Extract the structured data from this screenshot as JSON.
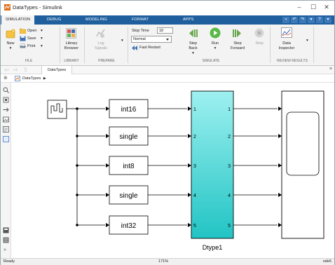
{
  "window": {
    "title": "DataTypes - Simulink",
    "minimize": "–",
    "maximize": "☐",
    "close": "✕"
  },
  "tabs": [
    {
      "label": "SIMULATION",
      "active": true
    },
    {
      "label": "DEBUG"
    },
    {
      "label": "MODELING"
    },
    {
      "label": "FORMAT"
    },
    {
      "label": "APPS"
    }
  ],
  "ribbon": {
    "file": {
      "group_label": "FILE",
      "new_label": "New",
      "open_label": "Open",
      "save_label": "Save",
      "print_label": "Print"
    },
    "library": {
      "group_label": "LIBRARY",
      "browser_label_1": "Library",
      "browser_label_2": "Browser"
    },
    "prepare": {
      "group_label": "PREPARE",
      "log_label_1": "Log",
      "log_label_2": "Signals"
    },
    "simulate": {
      "group_label": "SIMULATE",
      "stop_time_label": "Stop Time",
      "stop_time_value": "10",
      "mode_value": "Normal",
      "fast_restart_label": "Fast Restart",
      "step_back_1": "Step",
      "step_back_2": "Back",
      "run_label": "Run",
      "step_fwd_1": "Step",
      "step_fwd_2": "Forward",
      "stop_label": "Stop"
    },
    "review": {
      "group_label": "REVIEW RESULTS",
      "inspector_1": "Data",
      "inspector_2": "Inspector"
    }
  },
  "nav": {
    "tab_label": "DataTypes",
    "breadcrumb": "DataTypes"
  },
  "diagram": {
    "conversions": [
      "int16",
      "single",
      "int8",
      "single",
      "int32"
    ],
    "subsystem_name": "Dtype1",
    "ports_in": [
      "1",
      "2",
      "3",
      "4",
      "5"
    ],
    "ports_out": [
      "1",
      "2",
      "3",
      "4",
      "5"
    ],
    "colors": {
      "subsystem_fill_top": "#9ef0f0",
      "subsystem_fill_bottom": "#22c4c4",
      "line": "#000000"
    }
  },
  "status": {
    "left": "Ready",
    "zoom": "171%",
    "solver": "ode5"
  },
  "icons": {
    "app": "simulink-icon",
    "source": "signal-generator-icon",
    "scope": "scope-icon"
  }
}
